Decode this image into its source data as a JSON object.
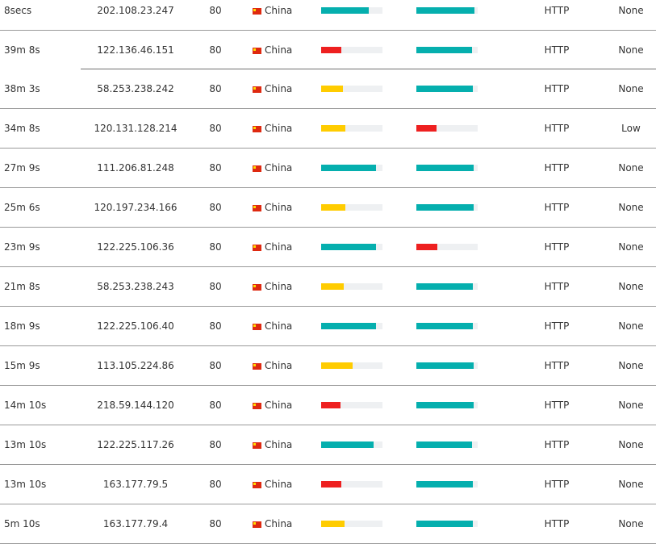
{
  "colors": {
    "green": "#05afae",
    "yellow": "#ffcc00",
    "red": "#ee2020",
    "track": "#eef0f2"
  },
  "proxies": [
    {
      "checked": "8secs",
      "ip": "202.108.23.247",
      "port": "80",
      "country": "China",
      "speed": 0.78,
      "speed_color": "green",
      "uptime": 0.95,
      "uptime_color": "green",
      "type": "HTTP",
      "anonymity": "None"
    },
    {
      "checked": "39m 8s",
      "ip": "122.136.46.151",
      "port": "80",
      "country": "China",
      "speed": 0.33,
      "speed_color": "red",
      "uptime": 0.91,
      "uptime_color": "green",
      "type": "HTTP",
      "anonymity": "None"
    },
    {
      "checked": "38m 3s",
      "ip": "58.253.238.242",
      "port": "80",
      "country": "China",
      "speed": 0.36,
      "speed_color": "yellow",
      "uptime": 0.92,
      "uptime_color": "green",
      "type": "HTTP",
      "anonymity": "None"
    },
    {
      "checked": "34m 8s",
      "ip": "120.131.128.214",
      "port": "80",
      "country": "China",
      "speed": 0.4,
      "speed_color": "yellow",
      "uptime": 0.33,
      "uptime_color": "red",
      "type": "HTTP",
      "anonymity": "Low"
    },
    {
      "checked": "27m 9s",
      "ip": "111.206.81.248",
      "port": "80",
      "country": "China",
      "speed": 0.9,
      "speed_color": "green",
      "uptime": 0.94,
      "uptime_color": "green",
      "type": "HTTP",
      "anonymity": "None"
    },
    {
      "checked": "25m 6s",
      "ip": "120.197.234.166",
      "port": "80",
      "country": "China",
      "speed": 0.4,
      "speed_color": "yellow",
      "uptime": 0.94,
      "uptime_color": "green",
      "type": "HTTP",
      "anonymity": "None"
    },
    {
      "checked": "23m 9s",
      "ip": "122.225.106.36",
      "port": "80",
      "country": "China",
      "speed": 0.9,
      "speed_color": "green",
      "uptime": 0.34,
      "uptime_color": "red",
      "type": "HTTP",
      "anonymity": "None"
    },
    {
      "checked": "21m 8s",
      "ip": "58.253.238.243",
      "port": "80",
      "country": "China",
      "speed": 0.37,
      "speed_color": "yellow",
      "uptime": 0.92,
      "uptime_color": "green",
      "type": "HTTP",
      "anonymity": "None"
    },
    {
      "checked": "18m 9s",
      "ip": "122.225.106.40",
      "port": "80",
      "country": "China",
      "speed": 0.9,
      "speed_color": "green",
      "uptime": 0.92,
      "uptime_color": "green",
      "type": "HTTP",
      "anonymity": "None"
    },
    {
      "checked": "15m 9s",
      "ip": "113.105.224.86",
      "port": "80",
      "country": "China",
      "speed": 0.51,
      "speed_color": "yellow",
      "uptime": 0.94,
      "uptime_color": "green",
      "type": "HTTP",
      "anonymity": "None"
    },
    {
      "checked": "14m 10s",
      "ip": "218.59.144.120",
      "port": "80",
      "country": "China",
      "speed": 0.32,
      "speed_color": "red",
      "uptime": 0.94,
      "uptime_color": "green",
      "type": "HTTP",
      "anonymity": "None"
    },
    {
      "checked": "13m 10s",
      "ip": "122.225.117.26",
      "port": "80",
      "country": "China",
      "speed": 0.85,
      "speed_color": "green",
      "uptime": 0.91,
      "uptime_color": "green",
      "type": "HTTP",
      "anonymity": "None"
    },
    {
      "checked": "13m 10s",
      "ip": "163.177.79.5",
      "port": "80",
      "country": "China",
      "speed": 0.33,
      "speed_color": "red",
      "uptime": 0.92,
      "uptime_color": "green",
      "type": "HTTP",
      "anonymity": "None"
    },
    {
      "checked": "5m 10s",
      "ip": "163.177.79.4",
      "port": "80",
      "country": "China",
      "speed": 0.38,
      "speed_color": "yellow",
      "uptime": 0.92,
      "uptime_color": "green",
      "type": "HTTP",
      "anonymity": "None"
    }
  ]
}
